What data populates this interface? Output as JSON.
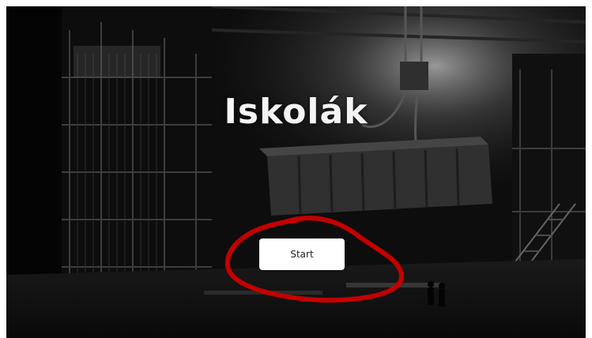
{
  "hero": {
    "title": "Iskolák",
    "background": "industrial-steelworks-photo",
    "annotation_color": "#c40000"
  },
  "start_button": {
    "label": "Start"
  }
}
